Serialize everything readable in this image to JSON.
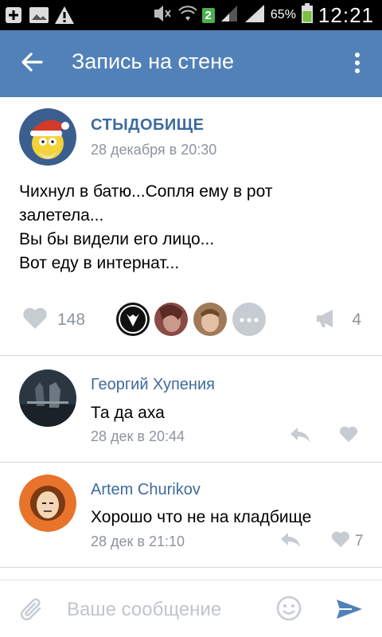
{
  "status_bar": {
    "network_badge": "2",
    "battery_percent": "65%",
    "time": "12:21"
  },
  "app_bar": {
    "title": "Запись на стене"
  },
  "post": {
    "author": "СТЫДОБИЩЕ",
    "date": "28 декабря в 20:30",
    "lines": [
      "Чихнул в батю...Сопля ему в рот",
      "залетела...",
      "Вы бы видели его лицо...",
      "Вот еду в интернат..."
    ],
    "like_count": "148",
    "repost_count": "4"
  },
  "comments": [
    {
      "author": "Георгий Хупения",
      "text": "Та да аха",
      "date": "28 дек в 20:44",
      "like_count": ""
    },
    {
      "author": "Artem Churikov",
      "text": "Хорошо что не на кладбище",
      "date": "28 дек в 21:10",
      "like_count": "7"
    }
  ],
  "composer": {
    "placeholder": "Ваше сообщение"
  },
  "colors": {
    "accent": "#5181b8",
    "link": "#3e6b9c",
    "muted": "#8d949c",
    "icon": "#c7ccd3"
  },
  "icons": {
    "back": "arrow-left-icon",
    "more": "more-vertical-icon",
    "like": "heart-icon",
    "repost": "megaphone-icon",
    "reply": "reply-arrow-icon",
    "attach": "paperclip-icon",
    "emoji": "smiley-icon",
    "send": "send-icon"
  }
}
